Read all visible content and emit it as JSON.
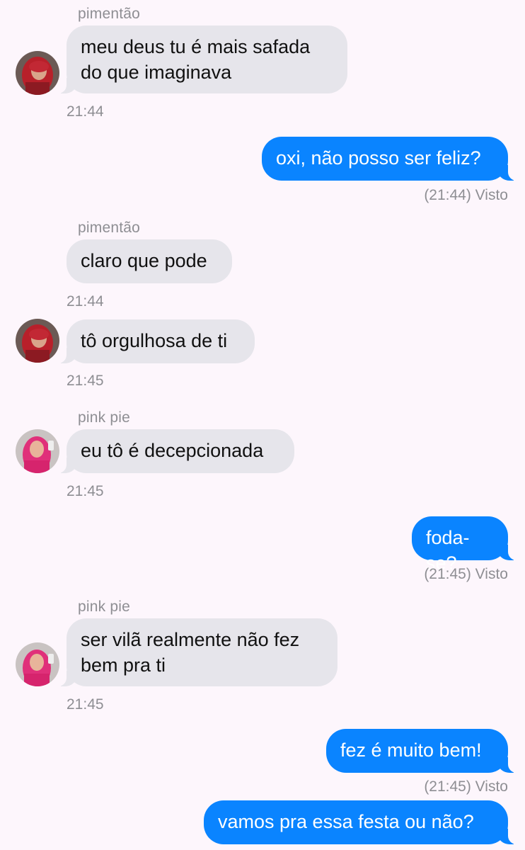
{
  "colors": {
    "background": "#fdf6fc",
    "incoming_bubble": "#e6e5eb",
    "outgoing_bubble": "#0a84ff",
    "meta_text": "#8e8e93"
  },
  "messages": [
    {
      "sender": "pimentão",
      "text": "meu deus tu é mais safada\ndo que imaginava",
      "time": "21:44"
    },
    {
      "text": "oxi, não posso ser feliz?",
      "status": "(21:44) Visto"
    },
    {
      "sender": "pimentão",
      "text": "claro que pode",
      "time": "21:44"
    },
    {
      "text": "tô orgulhosa de ti",
      "time": "21:45"
    },
    {
      "sender": "pink pie",
      "text": "eu tô é decepcionada",
      "time": "21:45"
    },
    {
      "text": "foda-se?",
      "status": "(21:45) Visto"
    },
    {
      "sender": "pink pie",
      "text": "ser vilã realmente não fez\nbem pra ti",
      "time": "21:45"
    },
    {
      "text": "fez é muito bem!",
      "status": "(21:45) Visto"
    },
    {
      "text": "vamos pra essa festa ou não?"
    }
  ],
  "avatars": {
    "pimentao": "avatar-red-hair",
    "pinkpie": "avatar-pink-hair"
  }
}
